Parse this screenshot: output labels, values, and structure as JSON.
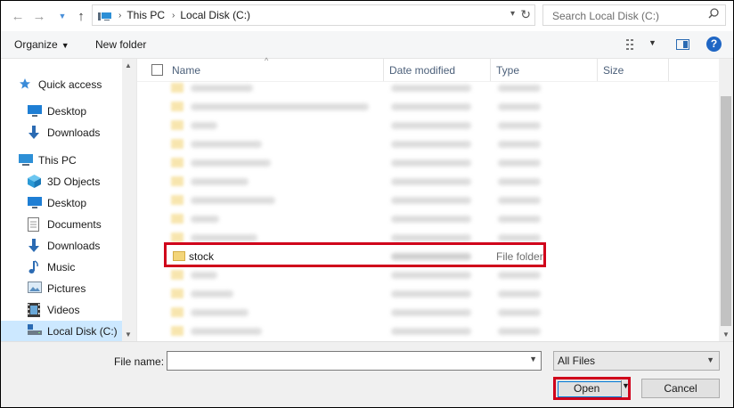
{
  "address_bar": {
    "back_icon": "arrow-left-icon",
    "forward_icon": "arrow-right-icon",
    "recent_icon": "chevron-down-icon",
    "up_icon": "arrow-up-icon",
    "path": [
      "This PC",
      "Local Disk (C:)"
    ],
    "search_placeholder": "Search Local Disk (C:)"
  },
  "toolbar": {
    "organize_label": "Organize",
    "new_folder_label": "New folder"
  },
  "nav": {
    "items": [
      {
        "label": "Quick access",
        "icon": "star-icon"
      },
      {
        "label": "Desktop",
        "icon": "desktop-icon"
      },
      {
        "label": "Downloads",
        "icon": "download-icon"
      },
      {
        "label": "This PC",
        "icon": "computer-icon"
      },
      {
        "label": "3D Objects",
        "icon": "cube-icon"
      },
      {
        "label": "Desktop",
        "icon": "desktop-icon"
      },
      {
        "label": "Documents",
        "icon": "document-icon"
      },
      {
        "label": "Downloads",
        "icon": "download-icon"
      },
      {
        "label": "Music",
        "icon": "music-icon"
      },
      {
        "label": "Pictures",
        "icon": "picture-icon"
      },
      {
        "label": "Videos",
        "icon": "video-icon"
      },
      {
        "label": "Local Disk (C:)",
        "icon": "drive-icon",
        "selected": true
      }
    ]
  },
  "columns": {
    "name": "Name",
    "date_modified": "Date modified",
    "type": "Type",
    "size": "Size"
  },
  "files": {
    "highlighted": {
      "name": "stock",
      "type": "File folder"
    }
  },
  "bottom": {
    "file_name_label": "File name:",
    "file_name_value": "",
    "filter_value": "All Files",
    "open_label": "Open",
    "cancel_label": "Cancel"
  },
  "colors": {
    "highlight_box": "#d0021b",
    "selected_nav": "#cce8ff",
    "folder": "#f3d57a"
  }
}
